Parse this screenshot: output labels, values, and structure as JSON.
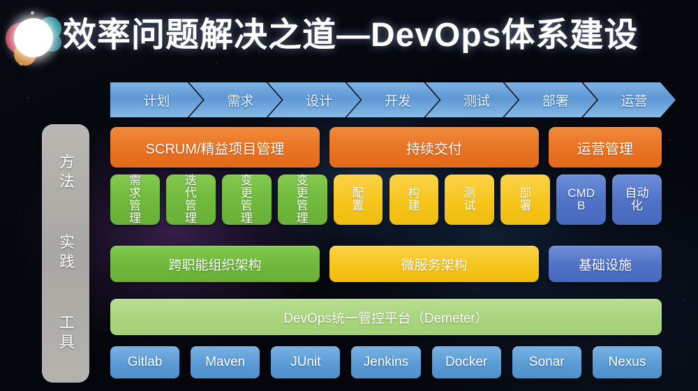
{
  "header": {
    "title": "效率问题解决之道—DevOps体系建设",
    "logo_name": "devops-circles-logo"
  },
  "phases": [
    {
      "label": "计划"
    },
    {
      "label": "需求"
    },
    {
      "label": "设计"
    },
    {
      "label": "开发"
    },
    {
      "label": "测试"
    },
    {
      "label": "部署"
    },
    {
      "label": "运营"
    }
  ],
  "rail": {
    "items": [
      {
        "label": "方法"
      },
      {
        "label": "实践"
      },
      {
        "label": "工具"
      }
    ]
  },
  "methods": [
    {
      "label": "SCRUM/精益项目管理",
      "color": "#ea7524"
    },
    {
      "label": "持续交付",
      "color": "#ea7524"
    },
    {
      "label": "运营管理",
      "color": "#ea7524"
    }
  ],
  "practices": [
    {
      "label": "需求管理",
      "lines": [
        "需",
        "求",
        "管",
        "理"
      ],
      "color": "#6fb93c",
      "kind": "green"
    },
    {
      "label": "迭代管理",
      "lines": [
        "迭",
        "代",
        "管",
        "理"
      ],
      "color": "#6fb93c",
      "kind": "green"
    },
    {
      "label": "变更管理",
      "lines": [
        "变",
        "更",
        "管",
        "理"
      ],
      "color": "#6fb93c",
      "kind": "green"
    },
    {
      "label": "变更管理",
      "lines": [
        "变",
        "更",
        "管",
        "理"
      ],
      "color": "#6fb93c",
      "kind": "green"
    },
    {
      "label": "配置",
      "lines": [
        "配",
        "置"
      ],
      "color": "#f6c61c",
      "kind": "yellow"
    },
    {
      "label": "构建",
      "lines": [
        "构",
        "建"
      ],
      "color": "#f6c61c",
      "kind": "yellow"
    },
    {
      "label": "测试",
      "lines": [
        "测",
        "试"
      ],
      "color": "#f6c61c",
      "kind": "yellow"
    },
    {
      "label": "部署",
      "lines": [
        "部",
        "署"
      ],
      "color": "#f6c61c",
      "kind": "yellow"
    },
    {
      "label": "CMDB",
      "lines": [
        "CMD",
        "B"
      ],
      "color": "#4f71c6",
      "kind": "blue"
    },
    {
      "label": "自动化",
      "lines": [
        "自动",
        "化"
      ],
      "color": "#4f71c6",
      "kind": "blue"
    }
  ],
  "architecture": [
    {
      "label": "跨职能组织架构",
      "color": "#6fb93c",
      "kind": "green"
    },
    {
      "label": "微服务架构",
      "color": "#f6c61c",
      "kind": "yellow"
    },
    {
      "label": "基础设施",
      "color": "#4f71c6",
      "kind": "blue"
    }
  ],
  "platform": {
    "label": "DevOps统一管控平台（Demeter）",
    "color": "#aad47f"
  },
  "tools": [
    {
      "label": "Gitlab"
    },
    {
      "label": "Maven"
    },
    {
      "label": "JUnit"
    },
    {
      "label": "Jenkins"
    },
    {
      "label": "Docker"
    },
    {
      "label": "Sonar"
    },
    {
      "label": "Nexus"
    }
  ],
  "palette": {
    "background": "#05070c",
    "phase_blue": "#5e97d4",
    "rail_gray": "#b0aea9",
    "method_orange": "#ea7524",
    "practice_green": "#6fb93c",
    "practice_yellow": "#f6c61c",
    "practice_blue": "#4f71c6",
    "platform_green": "#aad47f",
    "tool_blue": "#5b9bd5"
  }
}
